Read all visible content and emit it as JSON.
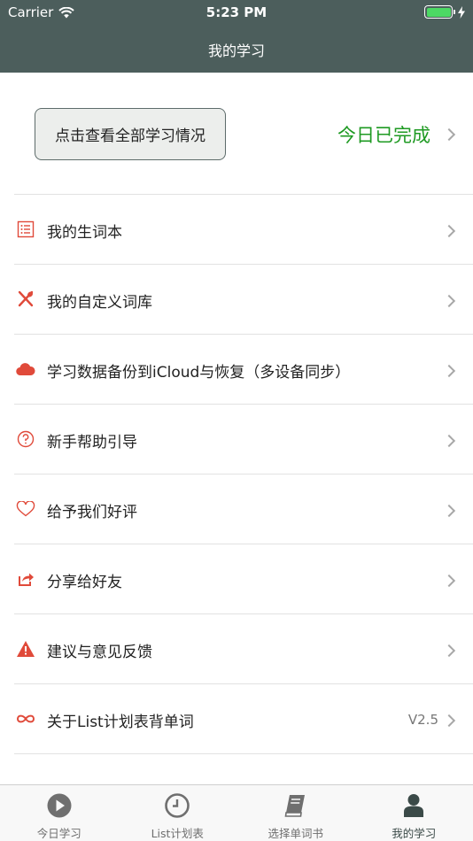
{
  "status_bar": {
    "carrier": "Carrier",
    "time": "5:23 PM"
  },
  "nav": {
    "title": "我的学习"
  },
  "summary": {
    "view_all_label": "点击查看全部学习情况",
    "status_text": "今日已完成"
  },
  "menu": [
    {
      "label": "我的生词本",
      "icon": "list-icon"
    },
    {
      "label": "我的自定义词库",
      "icon": "utensils-icon"
    },
    {
      "label": "学习数据备份到iCloud与恢复（多设备同步）",
      "icon": "cloud-icon"
    },
    {
      "label": "新手帮助引导",
      "icon": "question-icon"
    },
    {
      "label": "给予我们好评",
      "icon": "heart-icon"
    },
    {
      "label": "分享给好友",
      "icon": "share-icon"
    },
    {
      "label": "建议与意见反馈",
      "icon": "warning-icon"
    },
    {
      "label": "关于List计划表背单词",
      "icon": "infinity-icon",
      "value": "V2.5"
    }
  ],
  "tabs": [
    {
      "label": "今日学习",
      "icon": "play-icon"
    },
    {
      "label": "List计划表",
      "icon": "clock-icon"
    },
    {
      "label": "选择单词书",
      "icon": "book-icon"
    },
    {
      "label": "我的学习",
      "icon": "person-icon",
      "active": true
    }
  ],
  "colors": {
    "header": "#4c5e5c",
    "accent_red": "#e04a3a",
    "done_green": "#1e9a22"
  }
}
